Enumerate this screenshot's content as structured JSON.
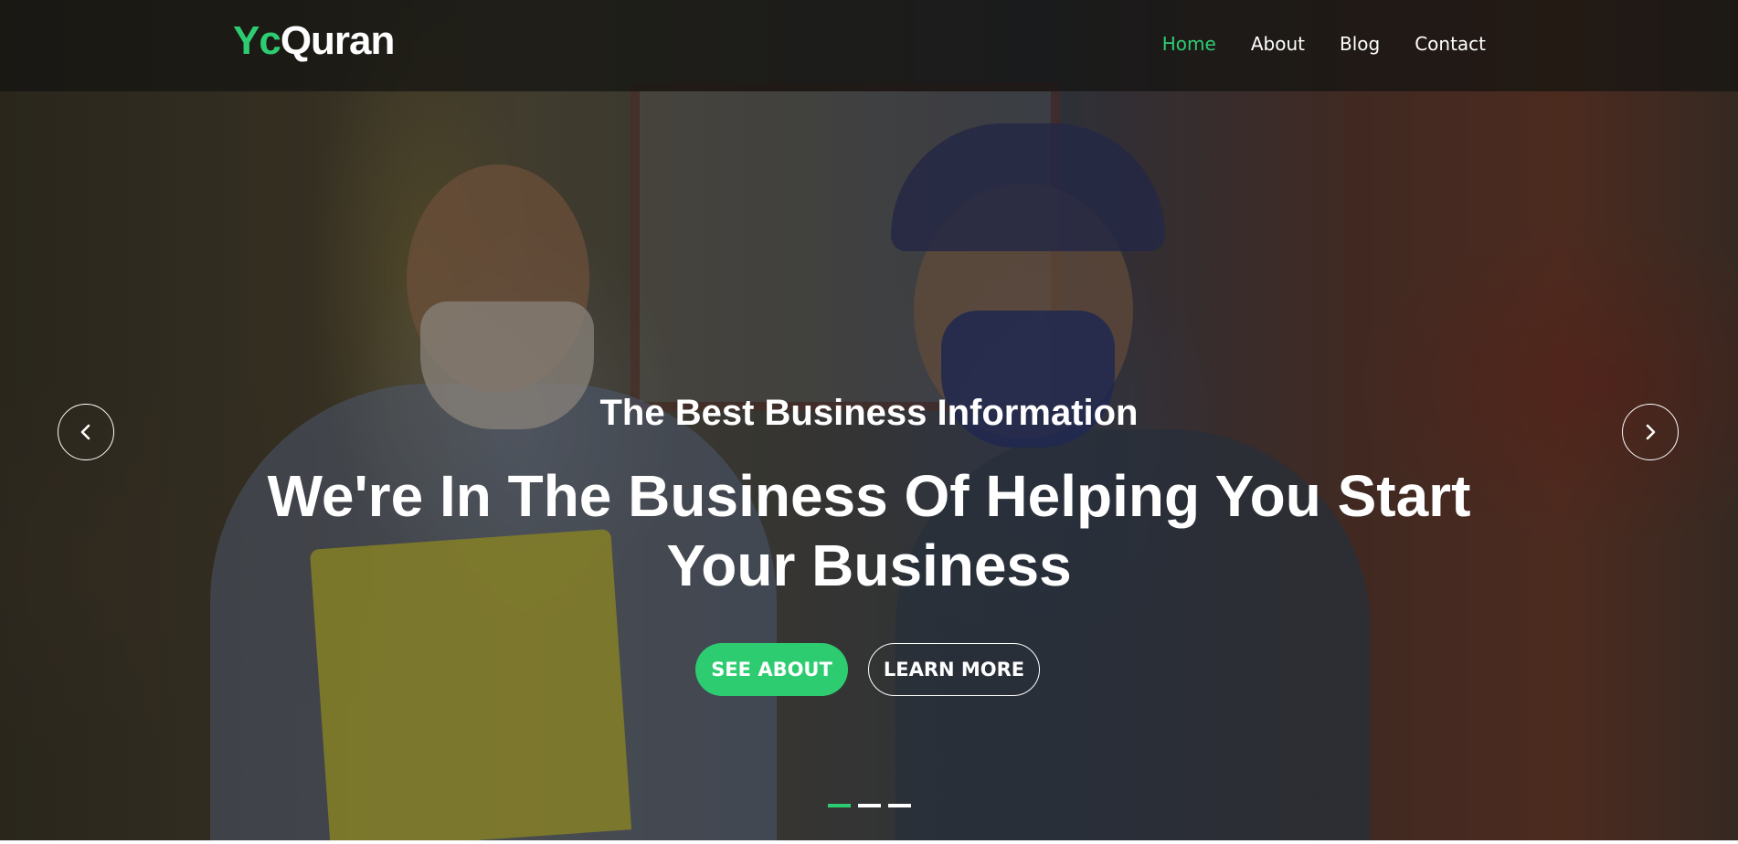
{
  "brand": {
    "logo_part1": "Yc",
    "logo_part2": "Quran",
    "accent_color": "#2ecc71"
  },
  "nav": {
    "items": [
      {
        "label": "Home",
        "active": true
      },
      {
        "label": "About",
        "active": false
      },
      {
        "label": "Blog",
        "active": false
      },
      {
        "label": "Contact",
        "active": false
      }
    ]
  },
  "hero": {
    "subtitle": "The Best Business Information",
    "title": "We're In The Business Of Helping You Start Your Business",
    "buttons": {
      "primary": "SEE ABOUT",
      "secondary": "LEARN MORE"
    },
    "prev_icon": "chevron-left-icon",
    "next_icon": "chevron-right-icon",
    "slide_count": 3,
    "active_slide": 1
  }
}
